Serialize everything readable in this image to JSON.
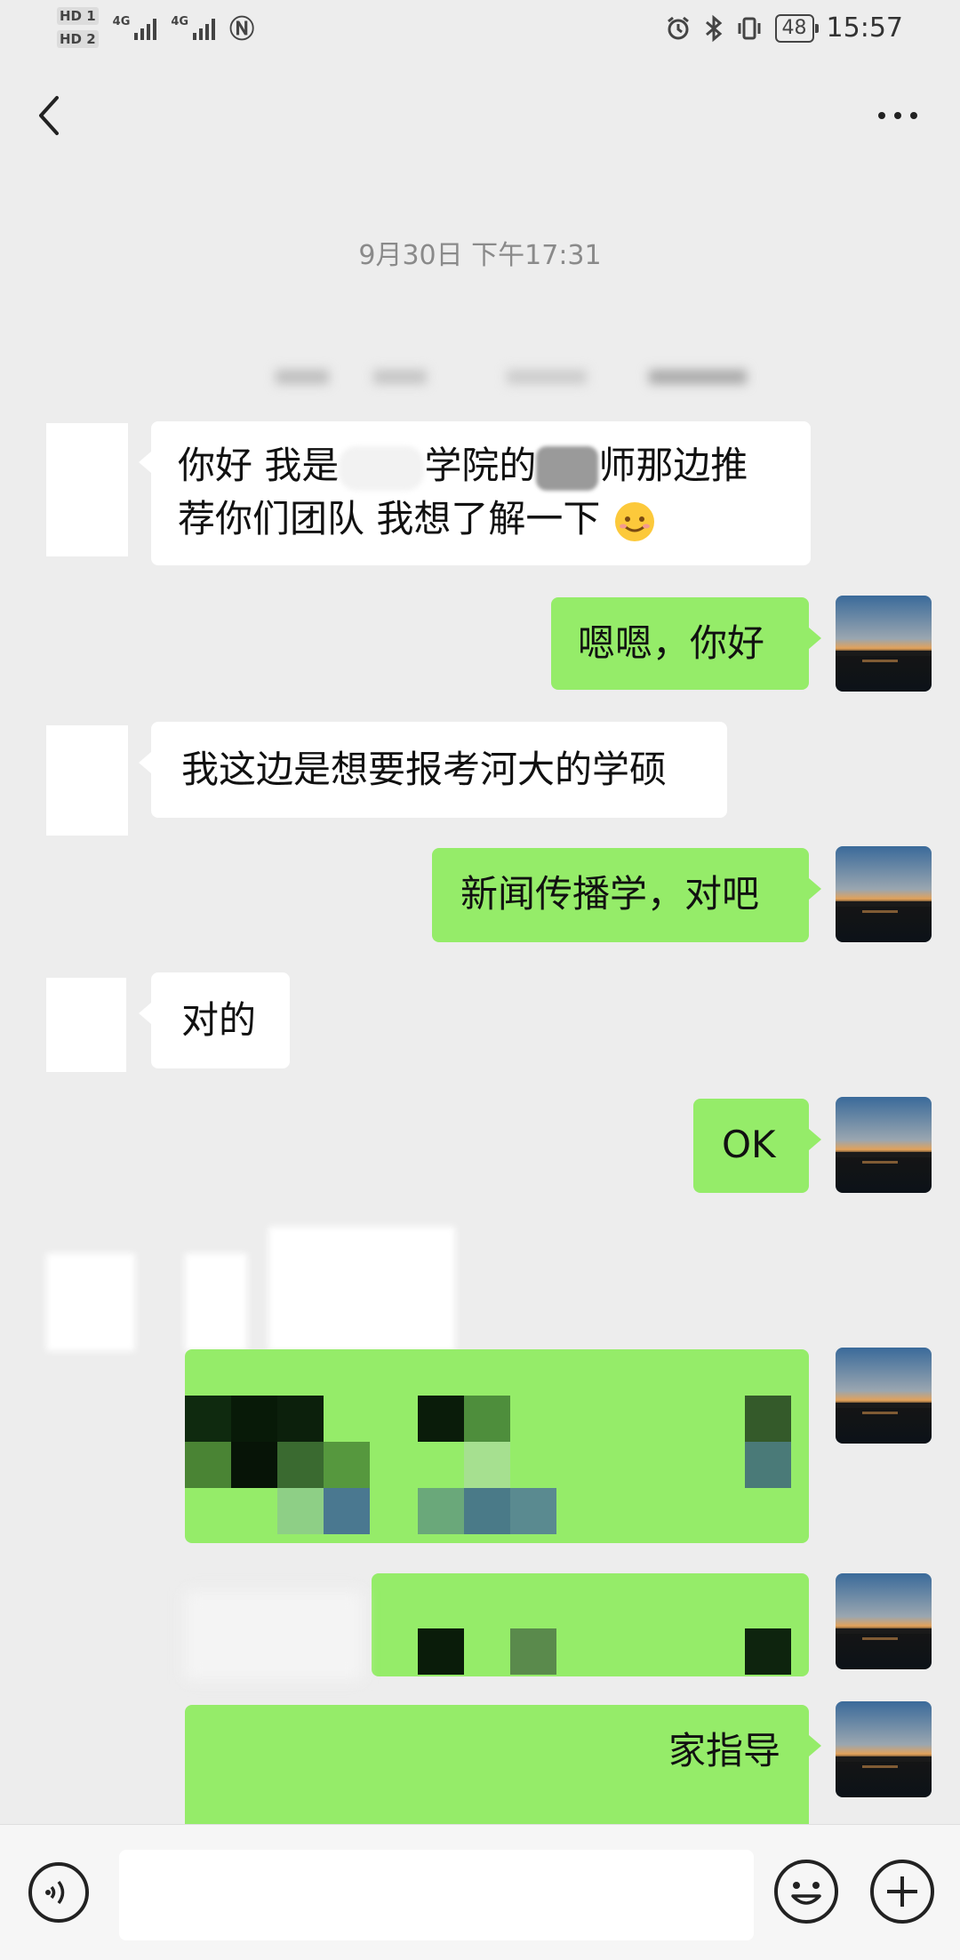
{
  "status_bar": {
    "hd1": "HD 1",
    "hd2": "HD 2",
    "signal1": "4G",
    "signal2": "4G",
    "battery": "48",
    "time": "15:57",
    "icons": [
      "alarm-icon",
      "bluetooth-icon",
      "vibrate-icon",
      "nfc-icon"
    ]
  },
  "nav": {
    "back_icon": "chevron-left-icon",
    "more_icon": "more-dots-icon"
  },
  "chat": {
    "timestamp": "9月30日 下午17:31",
    "messages": [
      {
        "side": "in",
        "line1": "你好 我是",
        "line1b": "学院的",
        "line1c": "师那边推",
        "line2": "荐你们团队 我想了解一下",
        "emoji": "smile-emoji"
      },
      {
        "side": "out",
        "text": "嗯嗯，你好"
      },
      {
        "side": "in",
        "text": "我这边是想要报考河大的学硕"
      },
      {
        "side": "out",
        "text": "新闻传播学，对吧"
      },
      {
        "side": "in",
        "text": "对的"
      },
      {
        "side": "out",
        "text": "OK"
      },
      {
        "side": "out",
        "text": "家指导"
      }
    ]
  },
  "input_bar": {
    "voice_icon": "voice-icon",
    "emoji_icon": "emoji-icon",
    "plus_icon": "plus-icon",
    "input_value": ""
  },
  "colors": {
    "background": "#ededed",
    "bubble_out": "#95ec69",
    "bubble_in": "#ffffff"
  }
}
